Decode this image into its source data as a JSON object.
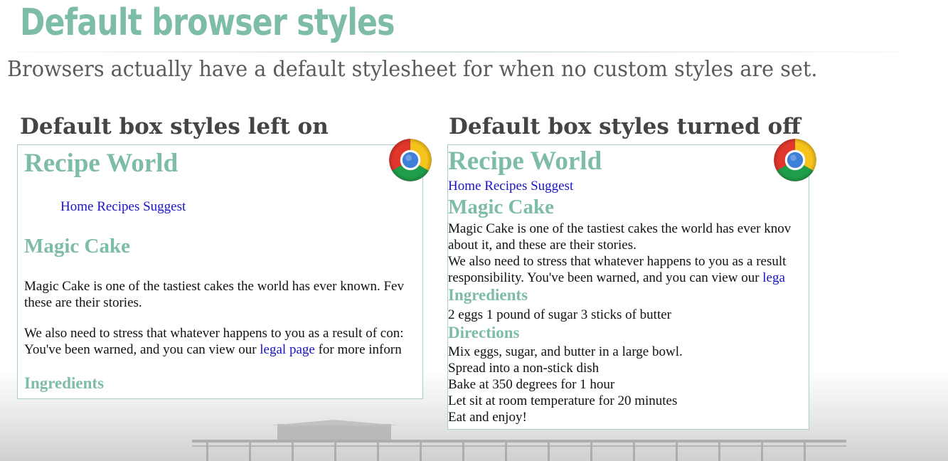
{
  "slide": {
    "title": "Default browser styles",
    "subtitle": "Browsers actually have a default stylesheet for when no custom styles are set."
  },
  "panels": {
    "left": {
      "heading": "Default box styles left on",
      "browser_icon": "chrome-icon",
      "site_title": "Recipe World",
      "nav": [
        "Home",
        "Recipes",
        "Suggest"
      ],
      "recipe_title": "Magic Cake",
      "para1_line1": "Magic Cake is one of the tastiest cakes the world has ever known. Fev",
      "para1_line2": "these are their stories.",
      "para2_line1": "We also need to stress that whatever happens to you as a result of con:",
      "para2_line2_before": "You've been warned, and you can view our ",
      "para2_link": "legal page",
      "para2_line2_after": " for more inforn",
      "ingredients_heading": "Ingredients"
    },
    "right": {
      "heading": "Default box styles turned off",
      "browser_icon": "chrome-icon",
      "site_title": "Recipe World",
      "nav": [
        "Home",
        "Recipes",
        "Suggest"
      ],
      "recipe_title": "Magic Cake",
      "para1_line1": "Magic Cake is one of the tastiest cakes the world has ever knov",
      "para1_line2": "about it, and these are their stories.",
      "para2_line1": "We also need to stress that whatever happens to you as a result",
      "para2_line2_before": "responsibility. You've been warned, and you can view our ",
      "para2_link": "lega",
      "ingredients_heading": "Ingredients",
      "ingredients": "2 eggs 1 pound of sugar 3 sticks of butter",
      "directions_heading": "Directions",
      "directions": [
        "Mix eggs, sugar, and butter in a large bowl.",
        "Spread into a non-stick dish",
        "Bake at 350 degrees for 1 hour",
        "Let sit at room temperature for 20 minutes",
        "Eat and enjoy!"
      ]
    }
  },
  "colors": {
    "accent_green": "#7dbca5",
    "link_blue": "#1a14c8",
    "heading_gray": "#444444",
    "subtitle_gray": "#5b5b5b"
  }
}
